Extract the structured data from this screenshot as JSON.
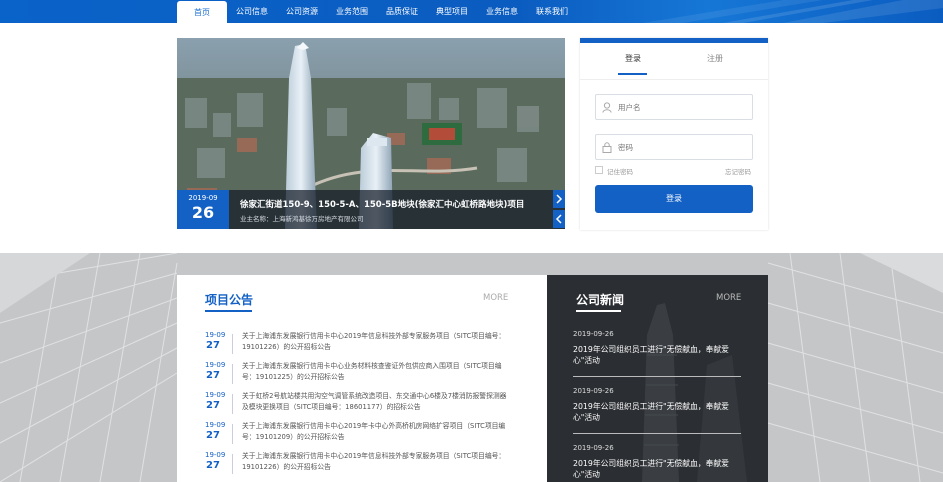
{
  "nav": {
    "items": [
      "首页",
      "公司信息",
      "公司资源",
      "业务范围",
      "品质保证",
      "典型项目",
      "业务信息",
      "联系我们"
    ],
    "active": "首页"
  },
  "banner": {
    "date_ym": "2019-09",
    "date_day": "26",
    "title": "徐家汇街道150-9、150-5-A、150-5B地块(徐家汇中心虹桥路地块)项目",
    "subtitle": "业主名称：上海新鸿基徐万房地产有限公司",
    "prev_icon": "chevron-right-icon",
    "next_icon": "chevron-left-icon"
  },
  "login": {
    "tab_login": "登录",
    "tab_register": "注册",
    "username_placeholder": "用户名",
    "password_placeholder": "密码",
    "remember": "记住密码",
    "forgot": "忘记密码",
    "submit": "登录"
  },
  "notice": {
    "title": "项目公告",
    "more": "MORE",
    "items": [
      {
        "md": "19-09",
        "day": "27",
        "text": "关于上海浦东发展银行信用卡中心2019年信息科技外部专家服务项目（SITC项目编号：19101226）的公开招标公告"
      },
      {
        "md": "19-09",
        "day": "27",
        "text": "关于上海浦东发展银行信用卡中心业务材料核查鉴证外包供应商入围项目（SITC项目编号：19101225）的公开招标公告"
      },
      {
        "md": "19-09",
        "day": "27",
        "text": "关于虹桥2号航站楼共用沟空气调管系统改造项目、东交通中心6楼及7楼消防报警探测器及模块更换项目（SITC项目编号：18601177）的招标公告"
      },
      {
        "md": "19-09",
        "day": "27",
        "text": "关于上海浦东发展银行信用卡中心2019年卡中心外高桥机房网络扩容项目（SITC项目编号：19101209）的公开招标公告"
      },
      {
        "md": "19-09",
        "day": "27",
        "text": "关于上海浦东发展银行信用卡中心2019年信息科技外部专家服务项目（SITC项目编号：19101226）的公开招标公告"
      }
    ]
  },
  "news": {
    "title": "公司新闻",
    "more": "MORE",
    "items": [
      {
        "date": "2019-09-26",
        "text": "2019年公司组织员工进行\"无偿献血，奉献爱心\"活动"
      },
      {
        "date": "2019-09-26",
        "text": "2019年公司组织员工进行\"无偿献血，奉献爱心\"活动"
      },
      {
        "date": "2019-09-26",
        "text": "2019年公司组织员工进行\"无偿献血，奉献爱心\"活动"
      }
    ]
  },
  "colors": {
    "brand": "#1361c5",
    "dark_panel": "#2b2e32"
  }
}
